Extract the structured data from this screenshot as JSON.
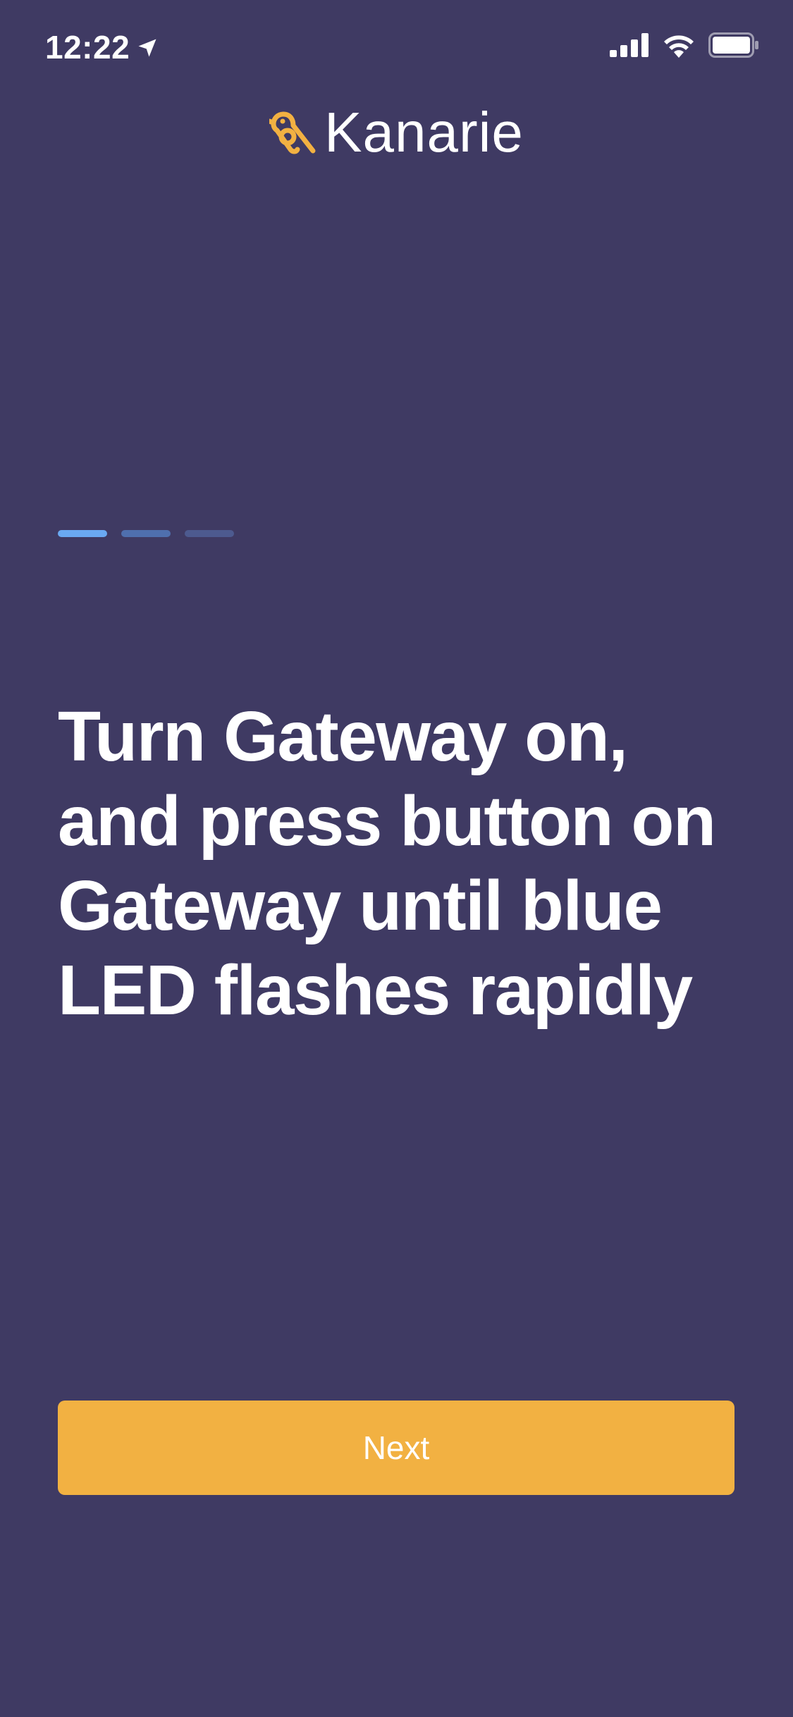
{
  "status_bar": {
    "time": "12:22",
    "location_icon": "location-arrow-icon",
    "signal_icon": "cellular-signal-icon",
    "wifi_icon": "wifi-icon",
    "battery_icon": "battery-icon"
  },
  "brand": {
    "name": "Kanarie",
    "logo_icon": "bird-logo-icon",
    "logo_color": "#f2b142"
  },
  "pager": {
    "current": 1,
    "total": 3,
    "active_color": "#6aa9f2",
    "inactive_colors": [
      "#4f6fae",
      "#4d5a8f"
    ]
  },
  "content": {
    "heading": "Turn Gateway on, and press button on Gateway until blue LED flashes rapidly"
  },
  "actions": {
    "next_label": "Next",
    "button_color": "#f2b142"
  },
  "colors": {
    "background": "#3f3a63"
  }
}
